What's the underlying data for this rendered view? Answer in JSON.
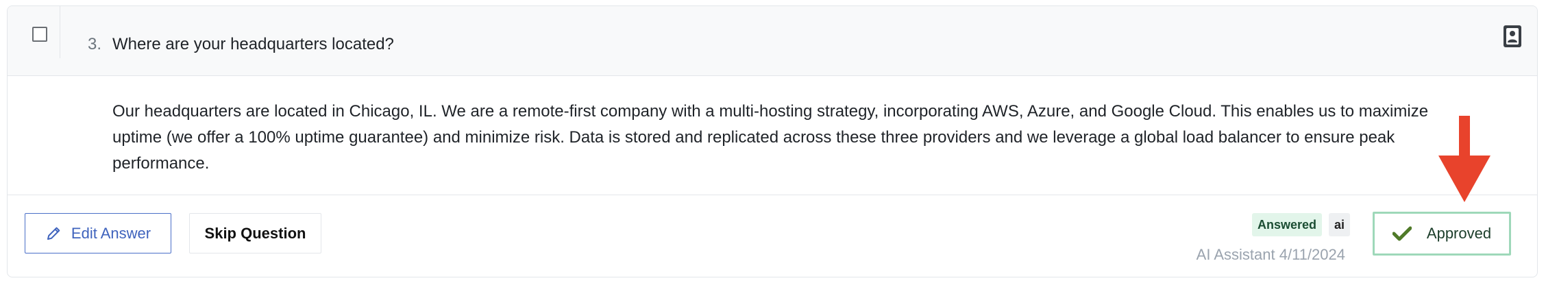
{
  "question": {
    "number": "3.",
    "text": "Where are your headquarters located?"
  },
  "answer": {
    "text": "Our headquarters are located in Chicago, IL. We are a remote-first company with a multi-hosting strategy, incorporating AWS, Azure, and Google Cloud. This enables us to maximize uptime (we offer a 100% uptime guarantee) and minimize risk. Data is stored and replicated across these three providers and we leverage a global load balancer to ensure peak performance."
  },
  "actions": {
    "edit_label": "Edit Answer",
    "skip_label": "Skip Question",
    "approved_label": "Approved"
  },
  "status": {
    "answered_badge": "Answered",
    "source_badge": "ai",
    "author": "AI Assistant",
    "date": "4/11/2024"
  },
  "icons": {
    "checkbox": "checkbox-unchecked",
    "contact": "contact-card-icon",
    "edit": "pencil-icon",
    "approved": "checkmark-icon",
    "annotation": "red-arrow-down"
  },
  "colors": {
    "edit_accent": "#3f63bd",
    "approved_border": "#9ed8b9",
    "approved_check": "#4f7a28",
    "answered_badge_bg": "#e2f5ea",
    "annotation_arrow": "#e8432c"
  }
}
